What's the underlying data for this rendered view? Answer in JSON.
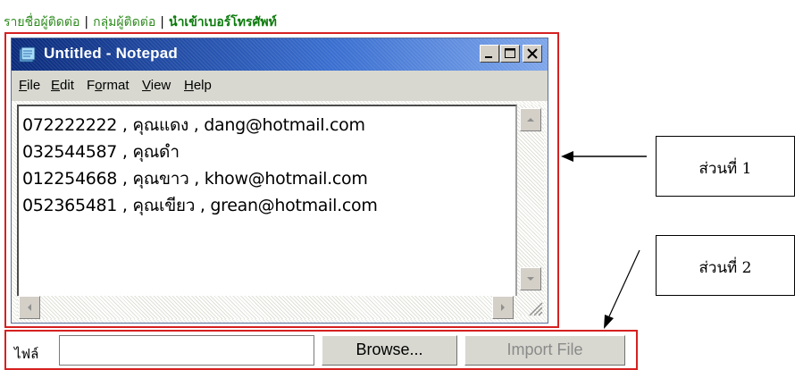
{
  "top_nav": {
    "items": [
      {
        "label": "รายชื่อผู้ติดต่อ",
        "bold": false
      },
      {
        "label": "กลุ่มผู้ติดต่อ",
        "bold": false
      },
      {
        "label": "นำเข้าเบอร์โทรศัพท์",
        "bold": true
      }
    ],
    "separator": "|"
  },
  "notepad": {
    "title": "Untitled - Notepad",
    "menu": [
      {
        "label": "File",
        "accel": "F"
      },
      {
        "label": "Edit",
        "accel": "E"
      },
      {
        "label": "Format",
        "accel": "o"
      },
      {
        "label": "View",
        "accel": "V"
      },
      {
        "label": "Help",
        "accel": "H"
      }
    ],
    "lines": [
      "072222222 , คุณแดง , dang@hotmail.com",
      "032544587 , คุณดำ",
      "012254668 , คุณขาว , khow@hotmail.com",
      "052365481 , คุณเขียว , grean@hotmail.com"
    ]
  },
  "annotations": {
    "part1": "ส่วนที่ 1",
    "part2": "ส่วนที่ 2"
  },
  "import_form": {
    "file_label": "ไฟล์",
    "file_value": "",
    "browse_label": "Browse...",
    "import_label": "Import File"
  },
  "colors": {
    "highlight_border": "#d62020",
    "nav_link": "#2e8b1e",
    "titlebar": "#0a2a7a"
  }
}
